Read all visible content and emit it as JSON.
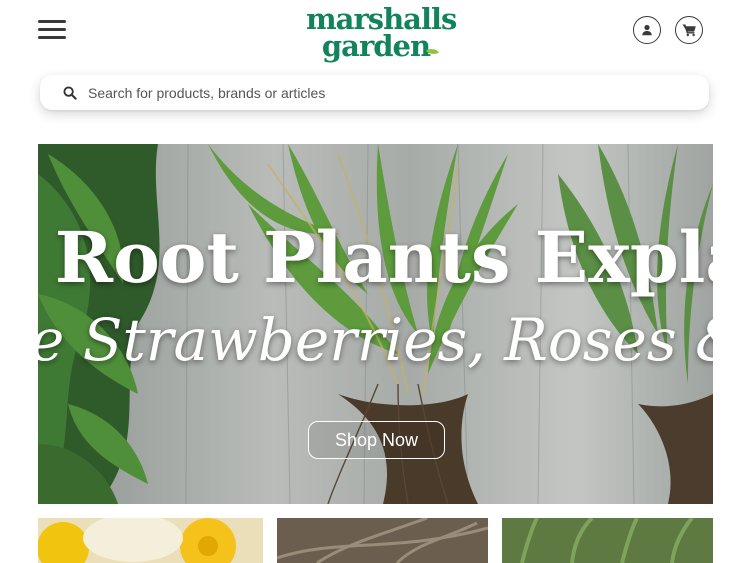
{
  "header": {
    "menu_icon": "hamburger-menu-icon",
    "logo_line1": "marshalls",
    "logo_line2": "garden",
    "account_icon": "account-icon",
    "cart_icon": "cart-icon",
    "brand_color": "#11845b",
    "leaf_color": "#8cc63f"
  },
  "search": {
    "icon": "search-icon",
    "placeholder": "Search for products, brands or articles"
  },
  "hero": {
    "title": "e Root Plants Expla",
    "subtitle": "e Strawberries, Roses & Be",
    "cta_label": "Shop Now"
  },
  "thumbnails": [
    {
      "name": "yellow-daffodil-image"
    },
    {
      "name": "brown-branches-image"
    },
    {
      "name": "green-grass-image"
    }
  ]
}
